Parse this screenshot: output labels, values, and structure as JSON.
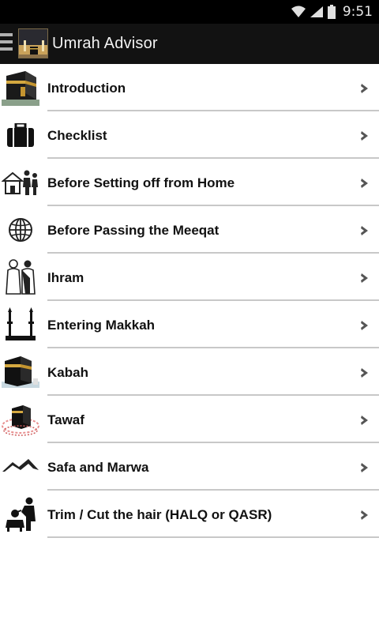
{
  "status_bar": {
    "time": "9:51",
    "icons": [
      "wifi-icon",
      "signal-icon",
      "battery-icon"
    ]
  },
  "action_bar": {
    "title": "Umrah Advisor",
    "icons": [
      "menu-icon",
      "app-logo"
    ]
  },
  "menu": {
    "items": [
      {
        "label": "Introduction",
        "icon": "kaaba-icon"
      },
      {
        "label": "Checklist",
        "icon": "suitcase-icon"
      },
      {
        "label": "Before Setting off from Home",
        "icon": "family-home-icon"
      },
      {
        "label": "Before Passing the Meeqat",
        "icon": "globe-icon"
      },
      {
        "label": "Ihram",
        "icon": "ihram-pilgrims-icon"
      },
      {
        "label": "Entering Makkah",
        "icon": "minarets-icon"
      },
      {
        "label": "Kabah",
        "icon": "kabah-icon"
      },
      {
        "label": "Tawaf",
        "icon": "tawaf-icon"
      },
      {
        "label": "Safa and Marwa",
        "icon": "hills-icon"
      },
      {
        "label": "Trim / Cut the hair (HALQ or QASR)",
        "icon": "barber-icon"
      }
    ]
  },
  "colors": {
    "status_bar_bg": "#000000",
    "action_bar_bg": "#121212",
    "list_bg": "#ffffff",
    "divider": "#c8c8c8",
    "chevron": "#555555"
  }
}
